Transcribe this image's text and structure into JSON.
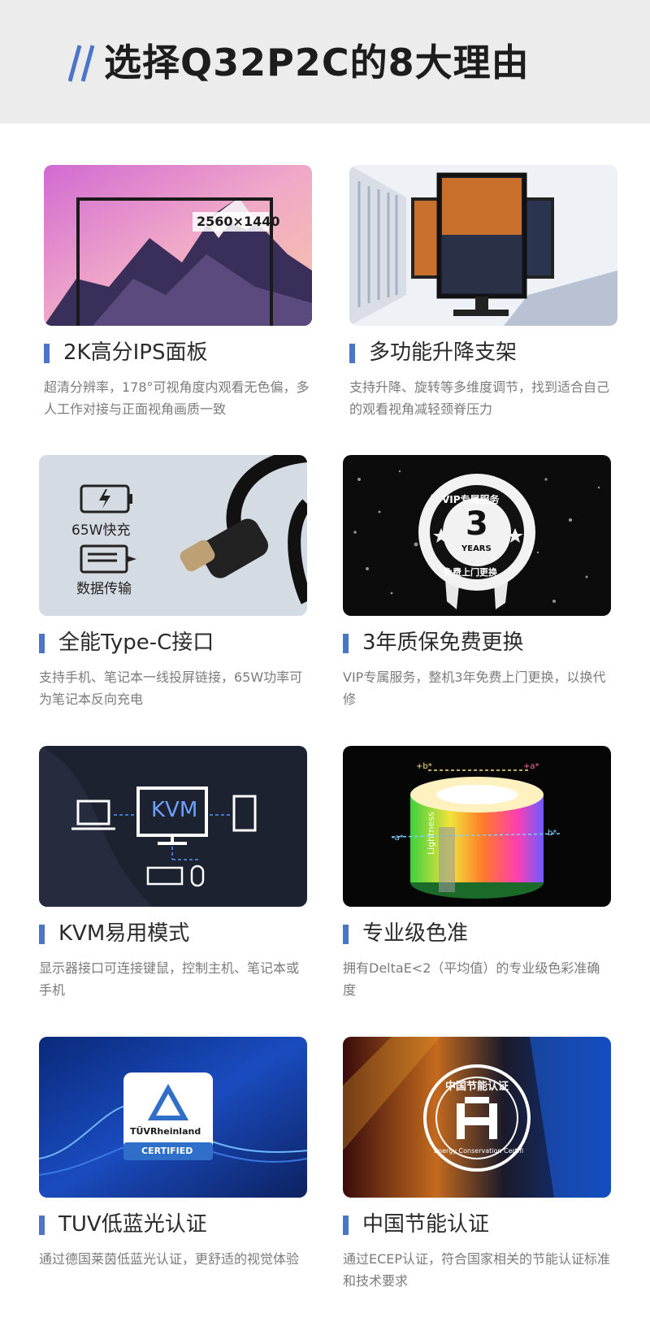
{
  "header": {
    "title": "选择Q32P2C的8大理由"
  },
  "features": [
    {
      "title": "2K高分IPS面板",
      "desc": "超清分辨率，178°可视角度内观看无色偏，多人工作对接与正面视角画质一致",
      "image_text": [
        "2560×1440"
      ]
    },
    {
      "title": "多功能升降支架",
      "desc": "支持升降、旋转等多维度调节，找到适合自己的观看视角减轻颈脊压力",
      "image_text": []
    },
    {
      "title": "全能Type-C接口",
      "desc": "支持手机、笔记本一线投屏链接，65W功率可为笔记本反向充电",
      "image_text": [
        "65W快充",
        "数据传输"
      ]
    },
    {
      "title": "3年质保免费更换",
      "desc": "VIP专属服务，整机3年免费上门更换，以换代修",
      "image_text": [
        "VIP专属服务",
        "3",
        "YEARS",
        "免费上门更换"
      ]
    },
    {
      "title": "KVM易用模式",
      "desc": "显示器接口可连接键鼠，控制主机、笔记本或手机",
      "image_text": [
        "KVM"
      ]
    },
    {
      "title": "专业级色准",
      "desc": "拥有DeltaE<2（平均值）的专业级色彩准确度",
      "image_text": [
        "+b*",
        "+a*",
        "-a*",
        "b*",
        "Lightness"
      ]
    },
    {
      "title": "TUV低蓝光认证",
      "desc": "通过德国莱茵低蓝光认证，更舒适的视觉体验",
      "image_text": [
        "TÜVRheinland",
        "CERTIFIED"
      ]
    },
    {
      "title": "中国节能认证",
      "desc": "通过ECEP认证，符合国家相关的节能认证标准和技术要求",
      "image_text": [
        "中国节能认证",
        "Energy Conservation Certifi"
      ]
    }
  ],
  "colors": {
    "accent": "#4a76c9",
    "banner_bg": "#ececec",
    "title_text": "#1d1d1d",
    "desc_text": "#7b7b7b"
  }
}
